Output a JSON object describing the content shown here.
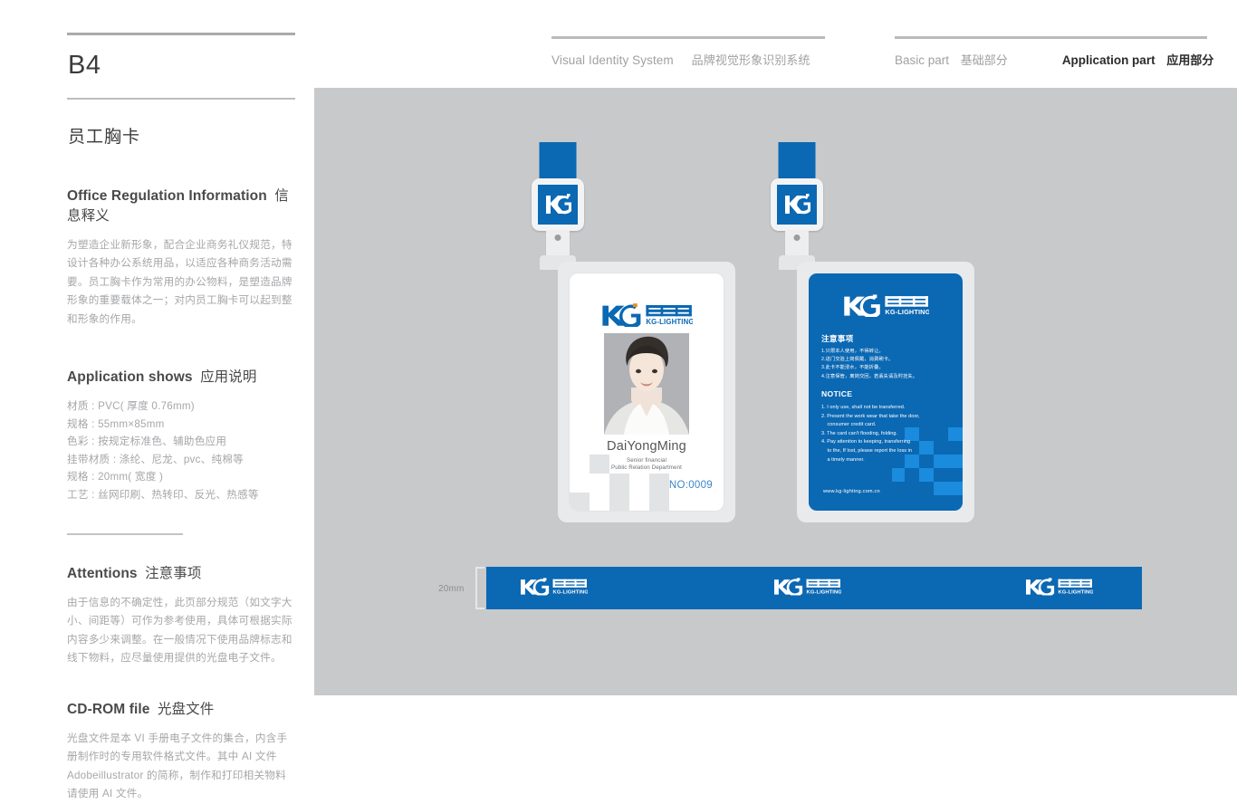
{
  "header": {
    "vis_en": "Visual Identity System",
    "vis_cn": "品牌视觉形象识别系统",
    "basic_en": "Basic part",
    "basic_cn": "基础部分",
    "app_en": "Application part",
    "app_cn": "应用部分"
  },
  "sidebar": {
    "page_code": "B4",
    "page_title": "员工胸卡",
    "section_info": {
      "heading_en": "Office Regulation Information",
      "heading_cn": "信息释义",
      "body": "为塑造企业新形象，配合企业商务礼仪规范，特设计各种办公系统用品，以适应各种商务活动需要。员工胸卡作为常用的办公物料，是塑造品牌形象的重要载体之一；对内员工胸卡可以起到整和形象的作用。"
    },
    "section_application": {
      "heading_en": "Application shows",
      "heading_cn": "应用说明",
      "lines": [
        "材质 : PVC( 厚度 0.76mm)",
        "规格 : 55mm×85mm",
        "色彩 : 按规定标准色、辅助色应用",
        "挂带材质 : 涤纶、尼龙、pvc、纯棉等",
        "规格 : 20mm( 宽度 )",
        "工艺 : 丝网印刷、热转印、反光、热感等"
      ]
    },
    "section_attentions": {
      "heading_en": "Attentions",
      "heading_cn": "注意事项",
      "body": "由于信息的不确定性，此页部分规范（如文字大小、间距等）可作为参考使用，具体可根据实际内容多少来调整。在一般情况下使用品牌标志和线下物料，应尽量使用提供的光盘电子文件。"
    },
    "section_cdrom": {
      "heading_en": "CD-ROM file",
      "heading_cn": "光盘文件",
      "body": "光盘文件是本 VI 手册电子文件的集合，内含手册制作时的专用软件格式文件。其中 AI 文件 Adobeillustrator 的简称，制作和打印相关物料请使用 AI 文件。"
    }
  },
  "brand": {
    "mark_letters": "KG",
    "name_cn": "皇智照明",
    "name_en": "KG-LIGHTING",
    "blue": "#0b68b3",
    "accent_orange": "#f08a1c",
    "canvas_gray": "#c8c9cb"
  },
  "badge_front": {
    "employee_name": "DaiYongMing",
    "role_line1": "Senior financial",
    "role_line2": "Public Relation Department",
    "card_number": "NO:0009"
  },
  "badge_back": {
    "notice_cn_heading": "注意事项",
    "notice_cn_lines": [
      "1.只限本人使用，不得转让。",
      "2.进门交验上岗佩戴，消费刷卡。",
      "3.此卡不能浸水，不能折叠。",
      "4.注意保管，离岗交回，若丢失请及时挂失。"
    ],
    "notice_en_heading": "NOTICE",
    "notice_en_lines": [
      "1. I only use, shall not be transferred.",
      "2. Present the work wear that take the door,",
      "consumer credit card.",
      "3. The card can't flooding, folding.",
      "4. Pay attention to keeping, transferring",
      "to the, If lost, please report the loss in",
      "a timely manner."
    ],
    "website": "www.kg-lighting.com.cn"
  },
  "lanyard": {
    "width_label": "20mm"
  }
}
